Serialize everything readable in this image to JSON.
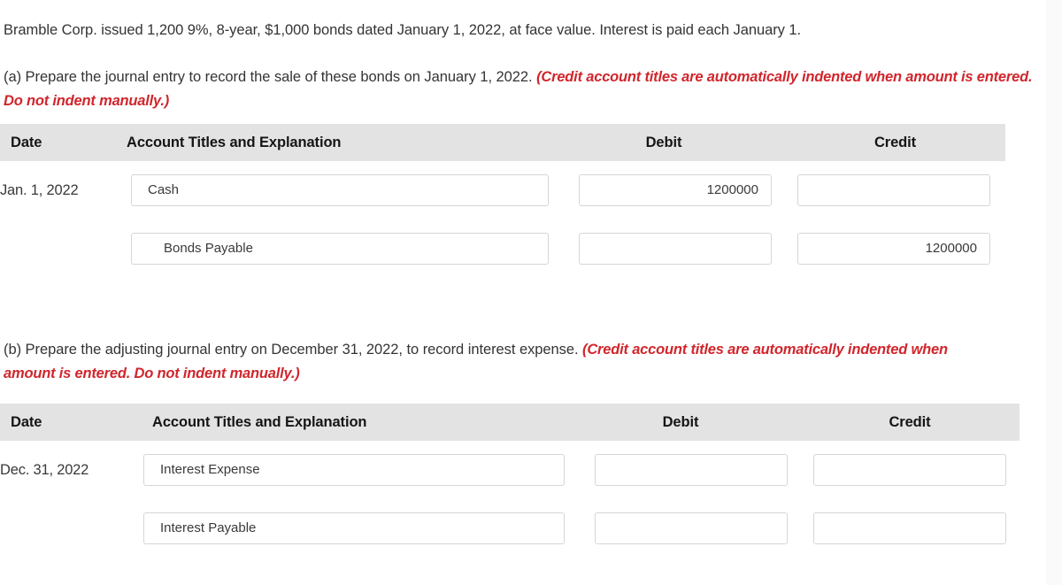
{
  "problem": {
    "intro": "Bramble Corp. issued 1,200 9%, 8-year, $1,000 bonds dated January 1, 2022, at face value. Interest is paid each January 1."
  },
  "parts": [
    {
      "id": "a",
      "prompt": "(a) Prepare the journal entry to record the sale of these bonds on January 1, 2022. ",
      "hint": "(Credit account titles are automatically indented when amount is entered. Do not indent manually.)",
      "table": {
        "columns": {
          "date": "Date",
          "account": "Account Titles and Explanation",
          "debit": "Debit",
          "credit": "Credit"
        },
        "rows": [
          {
            "date": "Jan. 1, 2022",
            "account": "Cash",
            "account_indented": false,
            "debit": "1200000",
            "credit": ""
          },
          {
            "date": "",
            "account": "Bonds Payable",
            "account_indented": true,
            "debit": "",
            "credit": "1200000"
          }
        ]
      }
    },
    {
      "id": "b",
      "prompt": "(b) Prepare the adjusting journal entry on December 31, 2022, to record interest expense. ",
      "hint": "(Credit account titles are automatically indented when amount is entered. Do not indent manually.)",
      "table": {
        "columns": {
          "date": "Date",
          "account": "Account Titles and Explanation",
          "debit": "Debit",
          "credit": "Credit"
        },
        "rows": [
          {
            "date": "Dec. 31, 2022",
            "account": "Interest Expense",
            "account_indented": false,
            "debit": "",
            "credit": ""
          },
          {
            "date": "",
            "account": "Interest Payable",
            "account_indented": false,
            "debit": "",
            "credit": ""
          }
        ]
      }
    }
  ],
  "colors": {
    "hint": "#d0262c",
    "header_bg": "#e3e3e3",
    "field_border": "#d6d6d6",
    "text": "#343434"
  }
}
